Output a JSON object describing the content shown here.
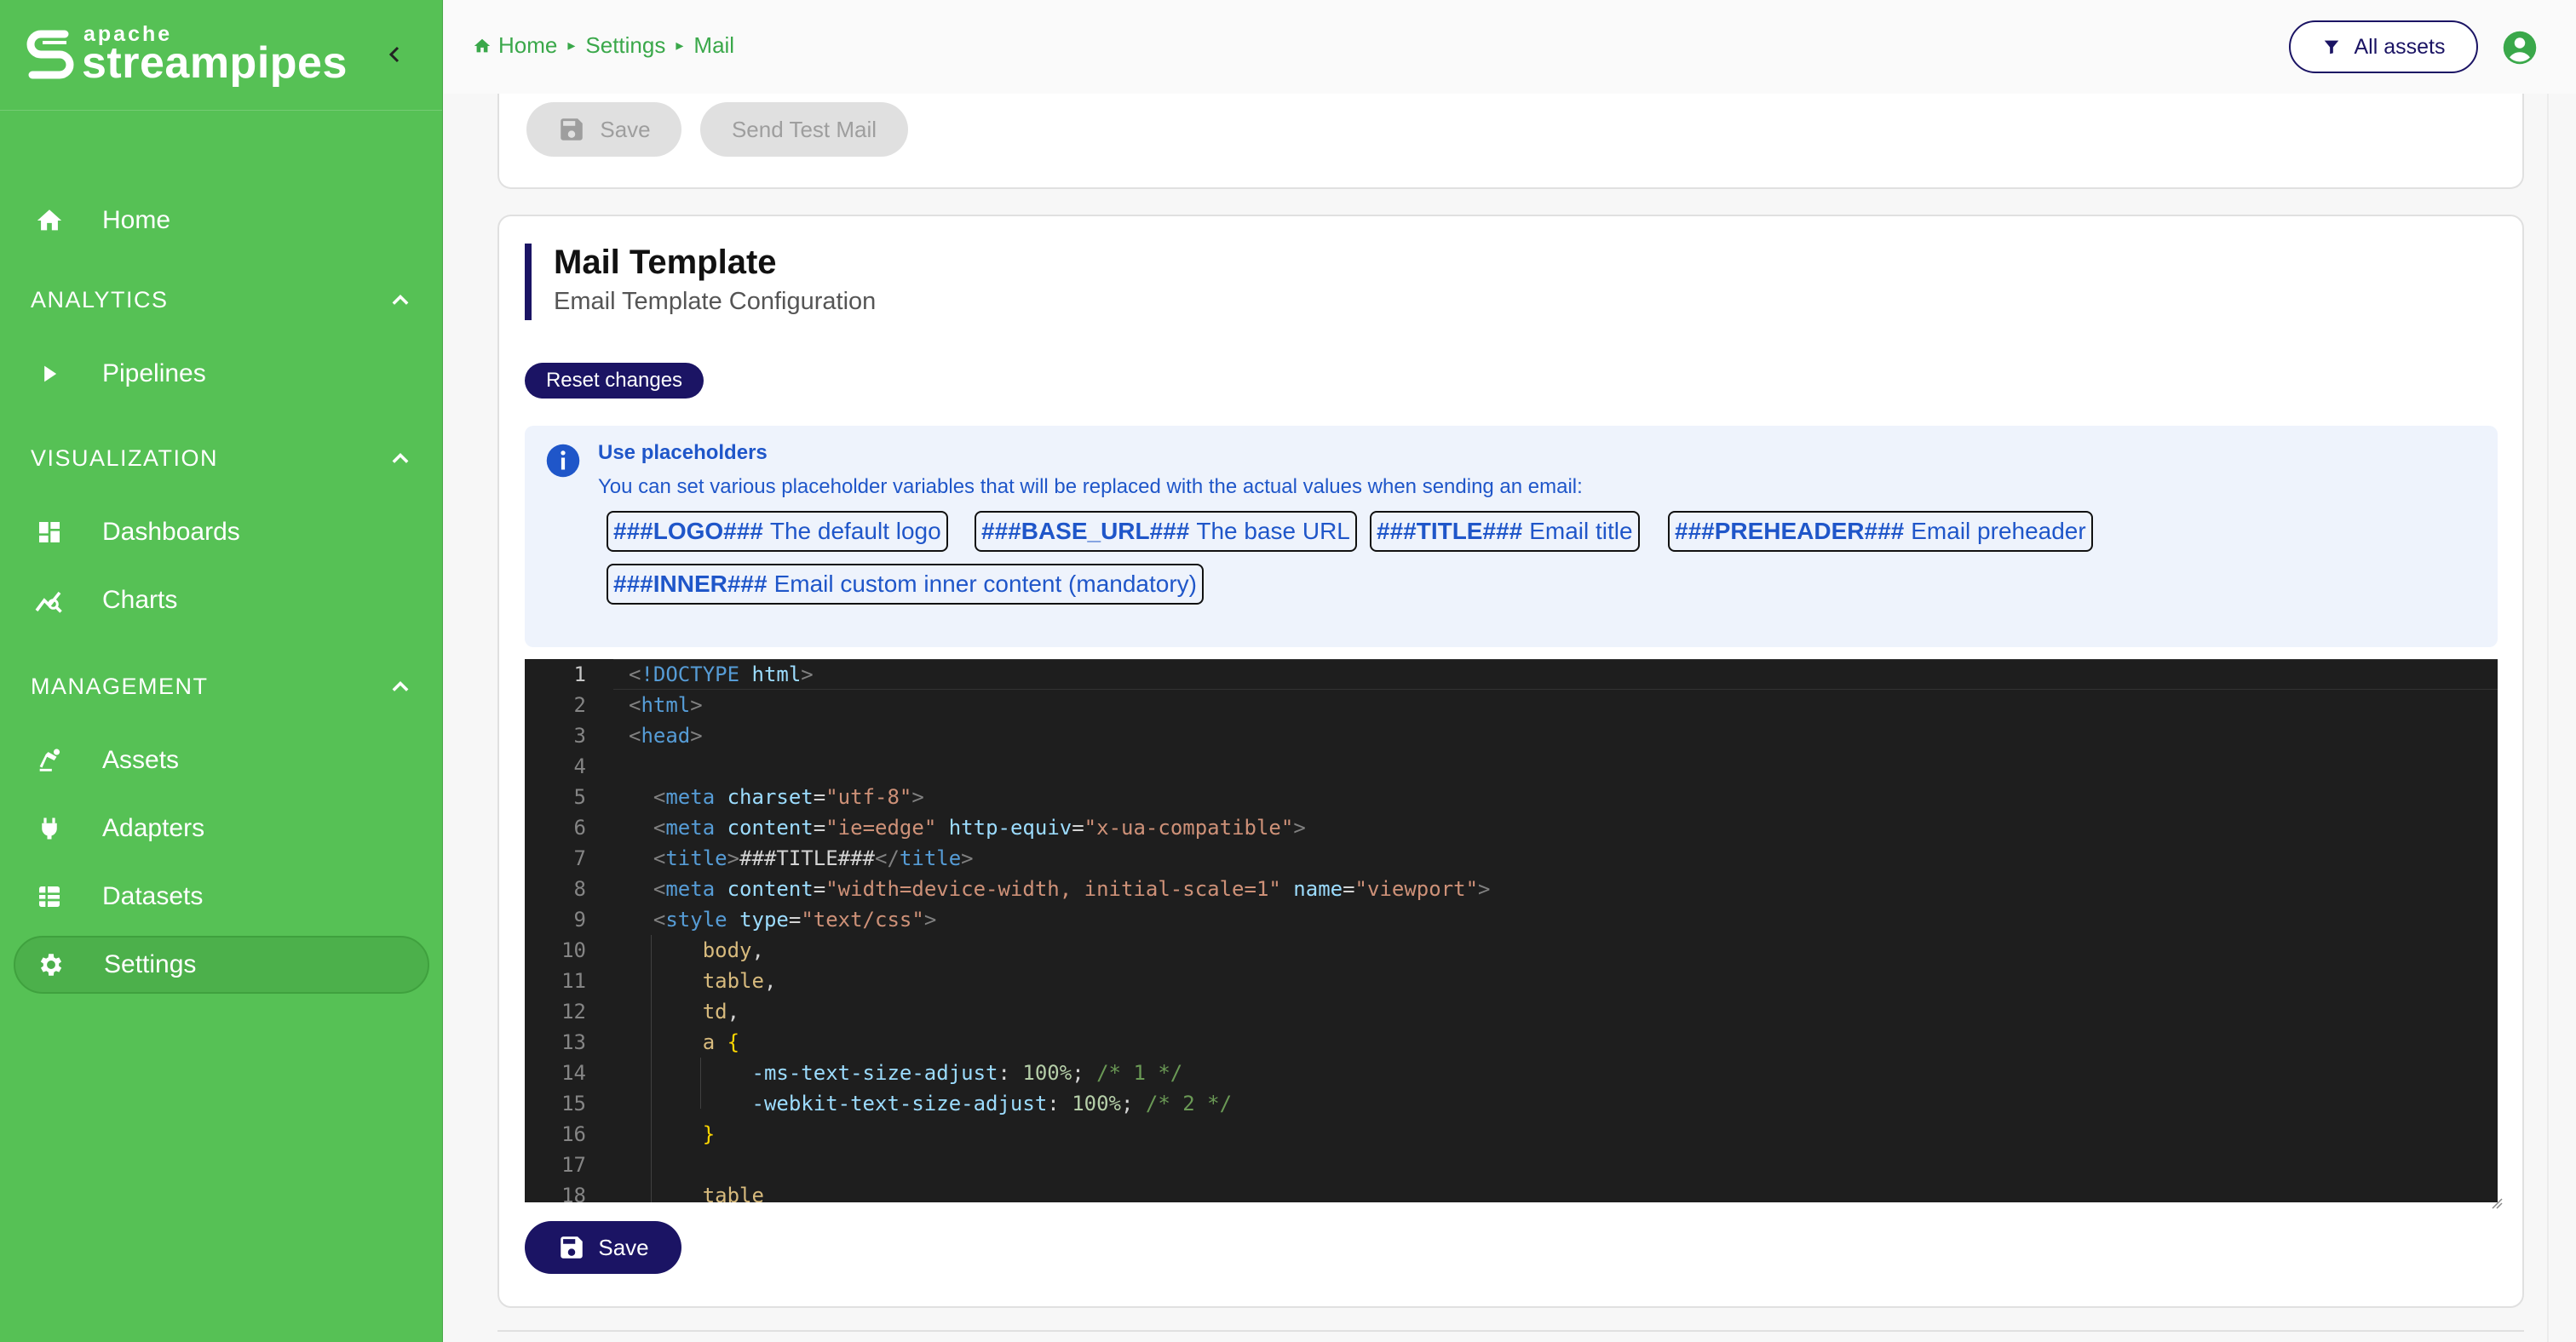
{
  "brand": {
    "top": "apache",
    "name": "streampipes"
  },
  "sidebar": {
    "home_label": "Home",
    "sections": [
      {
        "title": "ANALYTICS",
        "items": [
          {
            "label": "Pipelines",
            "icon": "play-icon"
          }
        ]
      },
      {
        "title": "VISUALIZATION",
        "items": [
          {
            "label": "Dashboards",
            "icon": "dashboard-icon"
          },
          {
            "label": "Charts",
            "icon": "chart-icon"
          }
        ]
      },
      {
        "title": "MANAGEMENT",
        "items": [
          {
            "label": "Assets",
            "icon": "precision-manufacturing-icon"
          },
          {
            "label": "Adapters",
            "icon": "plug-icon"
          },
          {
            "label": "Datasets",
            "icon": "grid-icon"
          },
          {
            "label": "Settings",
            "icon": "gear-icon",
            "active": true
          }
        ]
      }
    ]
  },
  "breadcrumb": {
    "items": [
      "Home",
      "Settings",
      "Mail"
    ]
  },
  "topbar": {
    "assets_label": "All assets"
  },
  "mail_config": {
    "save_label": "Save",
    "test_label": "Send Test Mail"
  },
  "template": {
    "title": "Mail Template",
    "subtitle": "Email Template Configuration",
    "reset_label": "Reset changes",
    "info_title": "Use placeholders",
    "info_text": "You can set various placeholder variables that will be replaced with the actual values when sending an email:",
    "placeholders": [
      {
        "key": "###LOGO###",
        "desc": "The default logo"
      },
      {
        "key": "###BASE_URL###",
        "desc": "The base URL"
      },
      {
        "key": "###TITLE###",
        "desc": "Email title"
      },
      {
        "key": "###PREHEADER###",
        "desc": "Email preheader"
      },
      {
        "key": "###INNER###",
        "desc": "Email custom inner content (mandatory)"
      }
    ],
    "save_label": "Save"
  },
  "editor": {
    "lines": [
      {
        "n": "1",
        "text": "<!DOCTYPE html>"
      },
      {
        "n": "2",
        "text": "<html>"
      },
      {
        "n": "3",
        "text": "<head>"
      },
      {
        "n": "4",
        "text": ""
      },
      {
        "n": "5",
        "text": "  <meta charset=\"utf-8\">"
      },
      {
        "n": "6",
        "text": "  <meta content=\"ie=edge\" http-equiv=\"x-ua-compatible\">"
      },
      {
        "n": "7",
        "text": "  <title>###TITLE###</title>"
      },
      {
        "n": "8",
        "text": "  <meta content=\"width=device-width, initial-scale=1\" name=\"viewport\">"
      },
      {
        "n": "9",
        "text": "  <style type=\"text/css\">"
      },
      {
        "n": "10",
        "text": "      body,"
      },
      {
        "n": "11",
        "text": "      table,"
      },
      {
        "n": "12",
        "text": "      td,"
      },
      {
        "n": "13",
        "text": "      a {"
      },
      {
        "n": "14",
        "text": "          -ms-text-size-adjust: 100%; /* 1 */"
      },
      {
        "n": "15",
        "text": "          -webkit-text-size-adjust: 100%; /* 2 */"
      },
      {
        "n": "16",
        "text": "      }"
      },
      {
        "n": "17",
        "text": ""
      },
      {
        "n": "18",
        "text": "      table"
      }
    ]
  },
  "colors": {
    "sidebar": "#56c155",
    "primary": "#1b1464",
    "info_text": "#1f56c9",
    "editor_bg": "#1e1e1e"
  }
}
